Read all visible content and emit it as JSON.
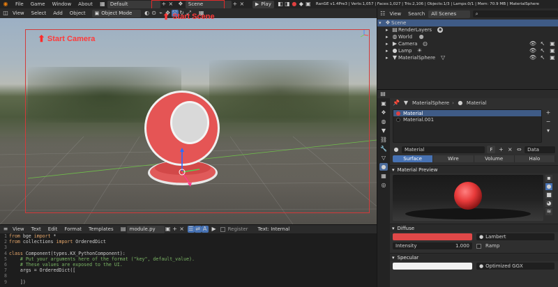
{
  "topbar": {
    "menus": [
      "File",
      "Game",
      "Window",
      "About"
    ],
    "layout": "Default",
    "scene": "Scene",
    "play_label": "Play",
    "stats": "RanGE v1.4Pre3 | Verts:1,057 | Faces:1,027 | Tris:2,106 | Objects:1/3 | Lamps:0/1 | Mem: 70.9 MB | MaterialSphere"
  },
  "viewport": {
    "menus": [
      "View",
      "Select",
      "Add",
      "Object"
    ],
    "mode": "Object Mode",
    "annotation_camera": "Start Camera",
    "annotation_scene": "Start Scene"
  },
  "text_editor": {
    "menus": [
      "View",
      "Text",
      "Edit",
      "Format",
      "Templates"
    ],
    "filename": "module.py",
    "register_label": "Register",
    "status": "Text: Internal",
    "lines": [
      {
        "n": "1",
        "a": "from",
        "b": " bge ",
        "c": "import",
        "d": " *",
        "type": "import"
      },
      {
        "n": "2",
        "a": "from",
        "b": " collections ",
        "c": "import",
        "d": " OrderedDict",
        "type": "import"
      },
      {
        "n": "3",
        "text": "",
        "type": "plain"
      },
      {
        "n": "4",
        "a": "class",
        "b": " Component(types.KX_PythonComponent):",
        "type": "kw"
      },
      {
        "n": "5",
        "text": "    # Put your arguments here of the format (\"key\", default_value).",
        "type": "comment"
      },
      {
        "n": "6",
        "text": "    # These values are exposed to the UI.",
        "type": "comment"
      },
      {
        "n": "7",
        "text": "    args = OrderedDict([",
        "type": "plain"
      },
      {
        "n": "8",
        "text": "",
        "type": "plain"
      },
      {
        "n": "9",
        "text": "    ])",
        "type": "plain"
      }
    ]
  },
  "outliner": {
    "menus": [
      "View",
      "Search"
    ],
    "filter": "All Scenes",
    "items": [
      {
        "label": "Scene",
        "indent": 0,
        "selected": true,
        "icon": "scene-icon"
      },
      {
        "label": "RenderLayers",
        "indent": 1,
        "icon": "renderlayers-icon"
      },
      {
        "label": "World",
        "indent": 1,
        "icon": "world-icon"
      },
      {
        "label": "Camera",
        "indent": 1,
        "icon": "camera-icon",
        "toggles": true
      },
      {
        "label": "Lamp",
        "indent": 1,
        "icon": "lamp-icon",
        "toggles": true
      },
      {
        "label": "MaterialSphere",
        "indent": 1,
        "icon": "mesh-icon",
        "toggles": true
      }
    ]
  },
  "properties": {
    "breadcrumb": [
      "MaterialSphere",
      "Material"
    ],
    "slots": [
      {
        "label": "Material",
        "color": "#e04040",
        "selected": true
      },
      {
        "label": "Material.001",
        "color": "#111111",
        "selected": false
      }
    ],
    "material_name": "Material",
    "fake_user": "F",
    "data_label": "Data",
    "types": [
      "Surface",
      "Wire",
      "Volume",
      "Halo"
    ],
    "active_type": "Surface",
    "preview_title": "Material Preview",
    "diffuse": {
      "title": "Diffuse",
      "color": "#e04848",
      "shader": "Lambert",
      "intensity_label": "Intensity",
      "intensity_value": "1.000",
      "ramp_label": "Ramp"
    },
    "specular": {
      "title": "Specular",
      "shader": "Optimized GGX"
    }
  },
  "colors": {
    "accent": "#4772b3",
    "selection": "#3f5b86",
    "annotation": "#ff3a3a",
    "play": "#3a3a3a"
  }
}
